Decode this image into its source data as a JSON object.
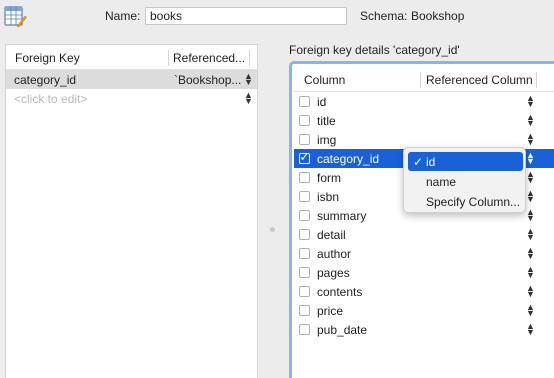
{
  "header": {
    "name_label": "Name:",
    "name_value": "books",
    "schema_label": "Schema:",
    "schema_value": "Bookshop"
  },
  "foreign_keys": {
    "columns": [
      "Foreign Key",
      "Referenced..."
    ],
    "rows": [
      {
        "key": "category_id",
        "referenced": "`Bookshop...",
        "selected": true
      },
      {
        "key": "<click to edit>",
        "referenced": "",
        "placeholder": true
      }
    ]
  },
  "details": {
    "title": "Foreign key details 'category_id'",
    "columns": [
      "Column",
      "Referenced Column"
    ],
    "rows": [
      {
        "name": "id",
        "checked": false
      },
      {
        "name": "title",
        "checked": false
      },
      {
        "name": "img",
        "checked": false
      },
      {
        "name": "category_id",
        "checked": true,
        "selected": true
      },
      {
        "name": "form",
        "checked": false
      },
      {
        "name": "isbn",
        "checked": false
      },
      {
        "name": "summary",
        "checked": false
      },
      {
        "name": "detail",
        "checked": false
      },
      {
        "name": "author",
        "checked": false
      },
      {
        "name": "pages",
        "checked": false
      },
      {
        "name": "contents",
        "checked": false
      },
      {
        "name": "price",
        "checked": false
      },
      {
        "name": "pub_date",
        "checked": false
      }
    ]
  },
  "dropdown": {
    "tick": "✓",
    "options": [
      {
        "label": "id",
        "selected": true
      },
      {
        "label": "name",
        "selected": false
      },
      {
        "label": "Specify Column...",
        "selected": false
      }
    ]
  },
  "icons": {
    "stepper": "updown-stepper-icon",
    "app": "table-editor-icon"
  },
  "colors": {
    "selection": "#1a60d6",
    "focus_ring": "#8ab3ec"
  }
}
